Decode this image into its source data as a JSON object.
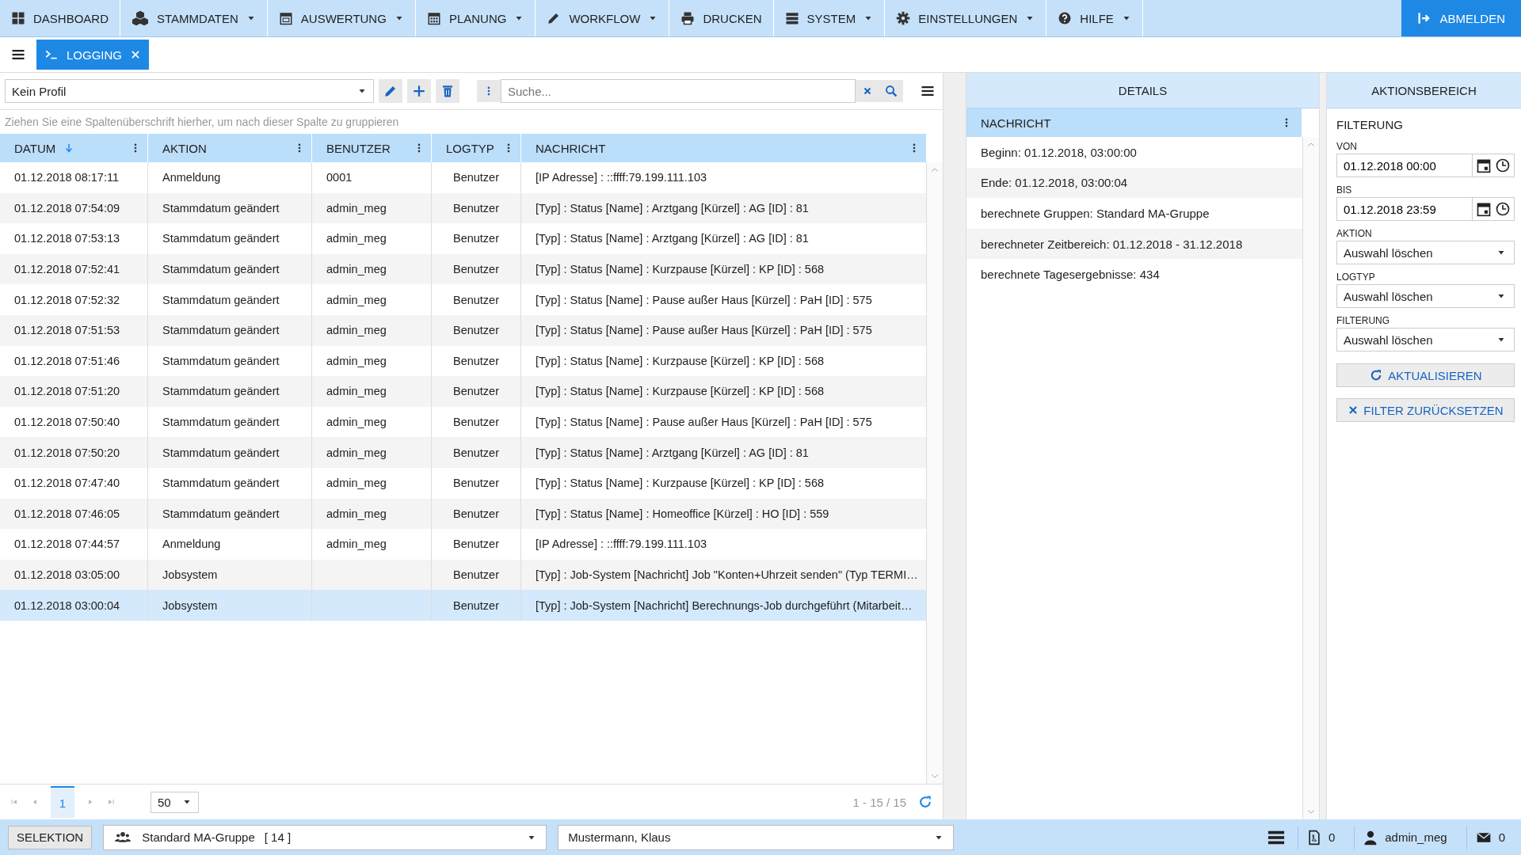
{
  "nav": {
    "items": [
      {
        "label": "DASHBOARD",
        "has_menu": false
      },
      {
        "label": "STAMMDATEN",
        "has_menu": true
      },
      {
        "label": "AUSWERTUNG",
        "has_menu": true
      },
      {
        "label": "PLANUNG",
        "has_menu": true
      },
      {
        "label": "WORKFLOW",
        "has_menu": true
      },
      {
        "label": "DRUCKEN",
        "has_menu": false
      },
      {
        "label": "SYSTEM",
        "has_menu": true
      },
      {
        "label": "EINSTELLUNGEN",
        "has_menu": true
      },
      {
        "label": "HILFE",
        "has_menu": true
      }
    ],
    "logout": "ABMELDEN"
  },
  "tabs": [
    {
      "label": "LOGGING",
      "selected": true
    }
  ],
  "toolbar": {
    "profile": "Kein Profil",
    "search_placeholder": "Suche..."
  },
  "group_hint": "Ziehen Sie eine Spaltenüberschrift hierher, um nach dieser Spalte zu gruppieren",
  "table": {
    "columns": [
      {
        "label": "DATUM",
        "sorted": true
      },
      {
        "label": "AKTION",
        "sorted": false
      },
      {
        "label": "BENUTZER",
        "sorted": false
      },
      {
        "label": "LOGTYP",
        "sorted": false
      },
      {
        "label": "NACHRICHT",
        "sorted": false
      }
    ],
    "rows": [
      {
        "cells": [
          "01.12.2018 08:17:11",
          "Anmeldung",
          "0001",
          "Benutzer",
          "[IP Adresse] : ::ffff:79.199.111.103"
        ],
        "selected": false
      },
      {
        "cells": [
          "01.12.2018 07:54:09",
          "Stammdatum geändert",
          "admin_meg",
          "Benutzer",
          "[Typ] : Status [Name] : Arztgang [Kürzel] : AG [ID] : 81"
        ],
        "selected": false
      },
      {
        "cells": [
          "01.12.2018 07:53:13",
          "Stammdatum geändert",
          "admin_meg",
          "Benutzer",
          "[Typ] : Status [Name] : Arztgang [Kürzel] : AG [ID] : 81"
        ],
        "selected": false
      },
      {
        "cells": [
          "01.12.2018 07:52:41",
          "Stammdatum geändert",
          "admin_meg",
          "Benutzer",
          "[Typ] : Status [Name] : Kurzpause [Kürzel] : KP [ID] : 568"
        ],
        "selected": false
      },
      {
        "cells": [
          "01.12.2018 07:52:32",
          "Stammdatum geändert",
          "admin_meg",
          "Benutzer",
          "[Typ] : Status [Name] : Pause außer Haus [Kürzel] : PaH [ID] : 575"
        ],
        "selected": false
      },
      {
        "cells": [
          "01.12.2018 07:51:53",
          "Stammdatum geändert",
          "admin_meg",
          "Benutzer",
          "[Typ] : Status [Name] : Pause außer Haus [Kürzel] : PaH [ID] : 575"
        ],
        "selected": false
      },
      {
        "cells": [
          "01.12.2018 07:51:46",
          "Stammdatum geändert",
          "admin_meg",
          "Benutzer",
          "[Typ] : Status [Name] : Kurzpause [Kürzel] : KP [ID] : 568"
        ],
        "selected": false
      },
      {
        "cells": [
          "01.12.2018 07:51:20",
          "Stammdatum geändert",
          "admin_meg",
          "Benutzer",
          "[Typ] : Status [Name] : Kurzpause [Kürzel] : KP [ID] : 568"
        ],
        "selected": false
      },
      {
        "cells": [
          "01.12.2018 07:50:40",
          "Stammdatum geändert",
          "admin_meg",
          "Benutzer",
          "[Typ] : Status [Name] : Pause außer Haus [Kürzel] : PaH [ID] : 575"
        ],
        "selected": false
      },
      {
        "cells": [
          "01.12.2018 07:50:20",
          "Stammdatum geändert",
          "admin_meg",
          "Benutzer",
          "[Typ] : Status [Name] : Arztgang [Kürzel] : AG [ID] : 81"
        ],
        "selected": false
      },
      {
        "cells": [
          "01.12.2018 07:47:40",
          "Stammdatum geändert",
          "admin_meg",
          "Benutzer",
          "[Typ] : Status [Name] : Kurzpause [Kürzel] : KP [ID] : 568"
        ],
        "selected": false
      },
      {
        "cells": [
          "01.12.2018 07:46:05",
          "Stammdatum geändert",
          "admin_meg",
          "Benutzer",
          "[Typ] : Status [Name] : Homeoffice [Kürzel] : HO [ID] : 559"
        ],
        "selected": false
      },
      {
        "cells": [
          "01.12.2018 07:44:57",
          "Anmeldung",
          "admin_meg",
          "Benutzer",
          "[IP Adresse] : ::ffff:79.199.111.103"
        ],
        "selected": false
      },
      {
        "cells": [
          "01.12.2018 03:05:00",
          "Jobsystem",
          "",
          "Benutzer",
          "[Typ] : Job-System [Nachricht] Job \"Konten+Uhrzeit senden\" (Typ TERMI…"
        ],
        "selected": false
      },
      {
        "cells": [
          "01.12.2018 03:00:04",
          "Jobsystem",
          "",
          "Benutzer",
          "[Typ] : Job-System [Nachricht] Berechnungs-Job durchgeführt (Mitarbeit…"
        ],
        "selected": true
      }
    ]
  },
  "pager": {
    "pages": [
      {
        "label": "1",
        "selected": true
      }
    ],
    "page_size": "50",
    "summary": "1 - 15 / 15"
  },
  "details": {
    "title": "DETAILS",
    "column": "NACHRICHT",
    "lines": [
      "Beginn: 01.12.2018, 03:00:00",
      "Ende: 01.12.2018, 03:00:04",
      "berechnete Gruppen: Standard MA-Gruppe",
      "berechneter Zeitbereich: 01.12.2018 - 31.12.2018",
      "berechnete Tagesergebnisse: 434"
    ]
  },
  "actions": {
    "title": "AKTIONSBEREICH",
    "section": "FILTERUNG",
    "dates": [
      {
        "label": "VON",
        "value": "01.12.2018 00:00"
      },
      {
        "label": "BIS",
        "value": "01.12.2018 23:59"
      }
    ],
    "selects": [
      {
        "label": "AKTION",
        "value": "Auswahl löschen"
      },
      {
        "label": "LOGTYP",
        "value": "Auswahl löschen"
      },
      {
        "label": "FILTERUNG",
        "value": "Auswahl löschen"
      }
    ],
    "refresh": "AKTUALISIEREN",
    "reset": "FILTER ZURÜCKSETZEN"
  },
  "status_bar": {
    "selection": "SELEKTION",
    "group": "Standard MA-Gruppe",
    "group_count": "[ 14 ]",
    "person": "Mustermann, Klaus",
    "pdf_count": "0",
    "user": "admin_meg",
    "mail_count": "0"
  }
}
